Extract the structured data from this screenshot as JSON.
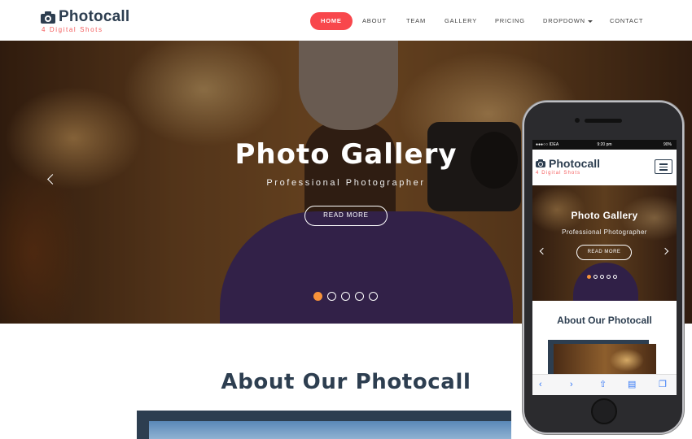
{
  "brand": {
    "name": "Photocall",
    "tagline": "4 Digital Shots",
    "primary_color": "#2d3e50",
    "accent_color": "#f8474c"
  },
  "nav": {
    "items": [
      {
        "label": "HOME",
        "active": true
      },
      {
        "label": "ABOUT"
      },
      {
        "label": "TEAM"
      },
      {
        "label": "GALLERY"
      },
      {
        "label": "PRICING"
      },
      {
        "label": "DROPDOWN"
      },
      {
        "label": "CONTACT"
      }
    ]
  },
  "hero": {
    "title": "Photo Gallery",
    "subtitle": "Professional Photographer",
    "button": "READ MORE",
    "slide_count": 5,
    "active_slide": 1,
    "dot_active_color": "#f7923a"
  },
  "about": {
    "title": "About Our Photocall"
  },
  "mobile": {
    "status": {
      "carrier": "●●●○○ IDEA",
      "time": "9:20 pm",
      "battery": "90%"
    },
    "brand_name": "Photocall",
    "tagline": "4 Digital Shots",
    "hero_title": "Photo Gallery",
    "hero_subtitle": "Professional Photographer",
    "hero_button": "READ MORE",
    "about_title": "About Our Photocall",
    "toolbar_icons": [
      "back-icon",
      "forward-icon",
      "share-icon",
      "bookmarks-icon",
      "tabs-icon"
    ]
  }
}
